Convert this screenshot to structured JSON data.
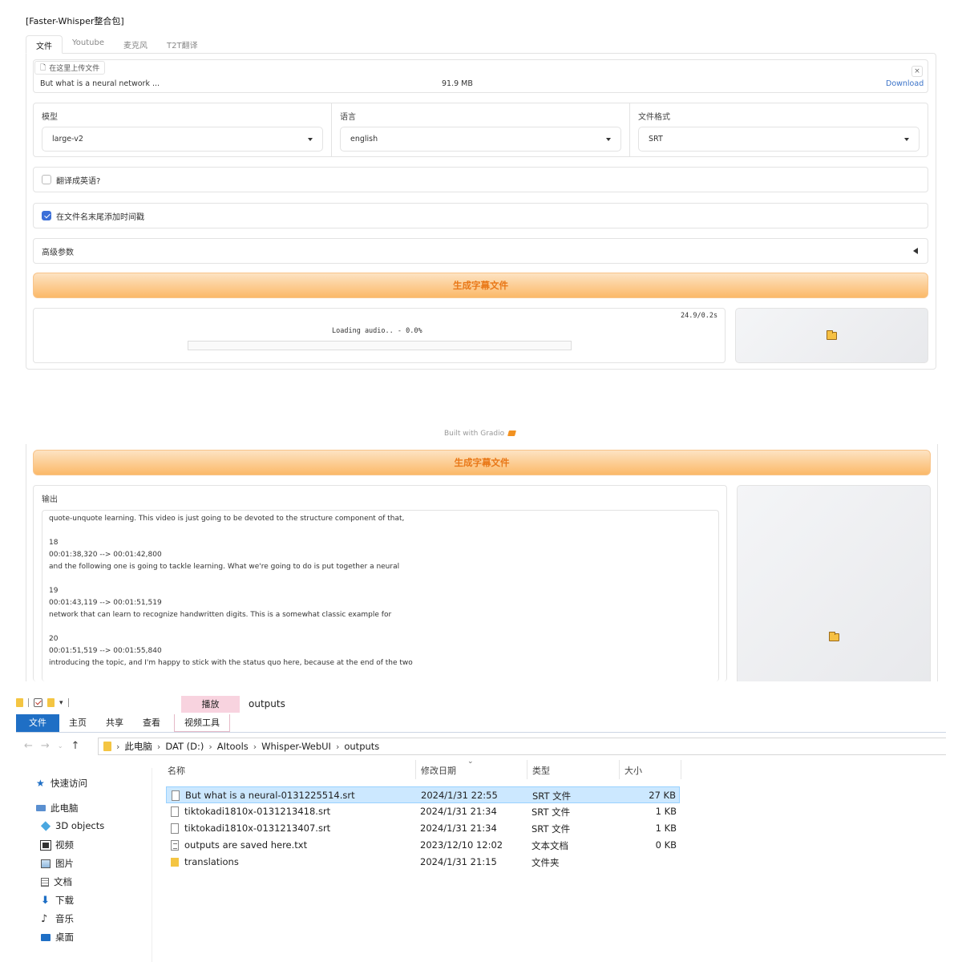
{
  "app": {
    "title": "[Faster-Whisper整合包]",
    "tabs": [
      "文件",
      "Youtube",
      "麦克风",
      "T2T翻译"
    ]
  },
  "file_upload": {
    "chip_label": "在这里上传文件",
    "file_name": "But what is a neural network ...",
    "file_size": "91.9 MB",
    "download_label": "Download",
    "close_label": "×"
  },
  "model": {
    "label": "模型",
    "value": "large-v2"
  },
  "language": {
    "label": "语言",
    "value": "english"
  },
  "format": {
    "label": "文件格式",
    "value": "SRT"
  },
  "options": {
    "translate_label": "翻译成英语?",
    "translate_checked": false,
    "timestamp_label": "在文件名末尾添加时间戳",
    "timestamp_checked": true,
    "advanced_label": "高级参数"
  },
  "generate_button": "生成字幕文件",
  "progress": {
    "timer": "24.9/0.2s",
    "status": "Loading audio.. - 0.0%",
    "fraction": 0.0
  },
  "footer": {
    "built_with": "Built with Gradio"
  },
  "output": {
    "label": "输出",
    "lines": [
      "quote-unquote learning. This video is just going to be devoted to the structure component of that,",
      "",
      "18",
      "00:01:38,320 --> 00:01:42,800",
      "and the following one is going to tackle learning. What we're going to do is put together a neural",
      "",
      "19",
      "00:01:43,119 --> 00:01:51,519",
      "network that can learn to recognize handwritten digits. This is a somewhat classic example for",
      "",
      "20",
      "00:01:51,519 --> 00:01:55,840",
      "introducing the topic, and I'm happy to stick with the status quo here, because at the end of the two"
    ]
  },
  "explorer": {
    "context_tab": "播放",
    "window_title": "outputs",
    "ribbon_tabs": [
      "文件",
      "主页",
      "共享",
      "查看"
    ],
    "context_ribbon_tab": "视频工具",
    "qa_dropdown": "▾",
    "breadcrumb": [
      "此电脑",
      "DAT (D:)",
      "AItools",
      "Whisper-WebUI",
      "outputs"
    ],
    "nav_items": [
      {
        "label": "快速访问",
        "icon": "star-icon"
      },
      {
        "label": "此电脑",
        "icon": "computer-icon"
      },
      {
        "label": "3D objects",
        "icon": "cube-icon"
      },
      {
        "label": "视频",
        "icon": "film-icon"
      },
      {
        "label": "图片",
        "icon": "picture-icon"
      },
      {
        "label": "文档",
        "icon": "document-icon"
      },
      {
        "label": "下载",
        "icon": "download-icon"
      },
      {
        "label": "音乐",
        "icon": "music-icon"
      },
      {
        "label": "桌面",
        "icon": "desktop-icon"
      }
    ],
    "columns": {
      "name": "名称",
      "date": "修改日期",
      "type": "类型",
      "size": "大小"
    },
    "files": [
      {
        "name": "But what is a neural-0131225514.srt",
        "date": "2024/1/31 22:55",
        "type": "SRT 文件",
        "size": "27 KB",
        "kind": "file",
        "selected": true
      },
      {
        "name": "tiktokadi1810x-0131213418.srt",
        "date": "2024/1/31 21:34",
        "type": "SRT 文件",
        "size": "1 KB",
        "kind": "file",
        "selected": false
      },
      {
        "name": "tiktokadi1810x-0131213407.srt",
        "date": "2024/1/31 21:34",
        "type": "SRT 文件",
        "size": "1 KB",
        "kind": "file",
        "selected": false
      },
      {
        "name": "outputs are saved here.txt",
        "date": "2023/12/10 12:02",
        "type": "文本文档",
        "size": "0 KB",
        "kind": "txt",
        "selected": false
      },
      {
        "name": "translations",
        "date": "2024/1/31 21:15",
        "type": "文件夹",
        "size": "",
        "kind": "folder",
        "selected": false
      }
    ]
  },
  "colors": {
    "accent_orange": "#e97818",
    "checkbox_blue": "#3b6fd8",
    "explorer_file_tab": "#1f6fc5",
    "selection": "#cce8ff"
  }
}
